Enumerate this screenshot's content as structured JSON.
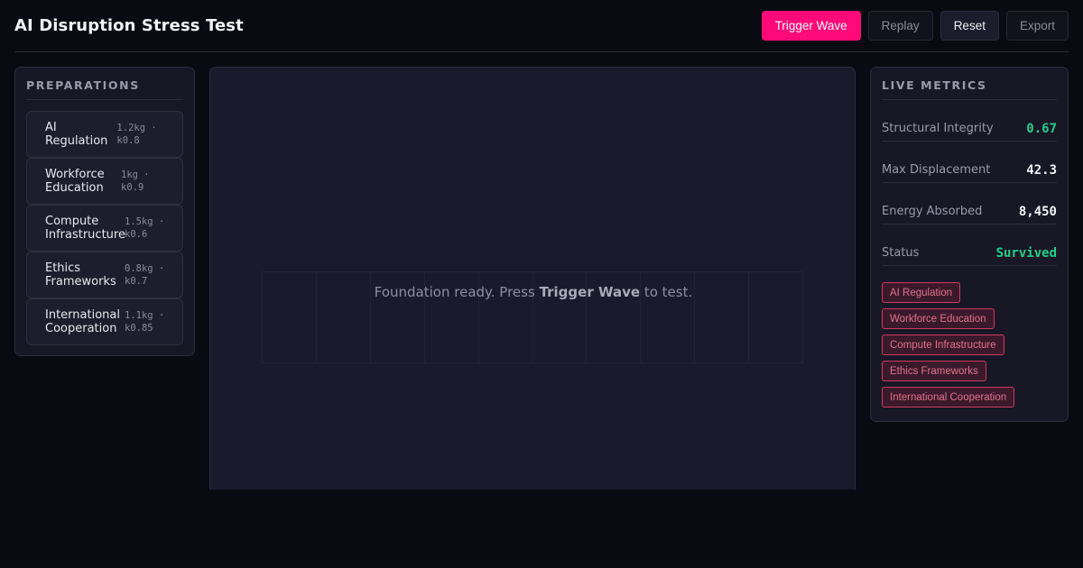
{
  "header": {
    "title": "AI Disruption Stress Test",
    "buttons": {
      "trigger": "Trigger Wave",
      "replay": "Replay",
      "reset": "Reset",
      "export": "Export"
    }
  },
  "preparations": {
    "title": "PREPARATIONS",
    "items": [
      {
        "name": "AI Regulation",
        "meta": "1.2kg · k0.8"
      },
      {
        "name": "Workforce Education",
        "meta": "1kg · k0.9"
      },
      {
        "name": "Compute Infrastructure",
        "meta": "1.5kg · k0.6"
      },
      {
        "name": "Ethics Frameworks",
        "meta": "0.8kg · k0.7"
      },
      {
        "name": "International Cooperation",
        "meta": "1.1kg · k0.85"
      }
    ]
  },
  "stage": {
    "message_prefix": "Foundation ready. Press",
    "message_action": "Trigger Wave",
    "message_suffix": "to test."
  },
  "metrics": {
    "title": "LIVE METRICS",
    "rows": [
      {
        "label": "Structural Integrity",
        "value": "0.67"
      },
      {
        "label": "Max Displacement",
        "value": "42.3"
      },
      {
        "label": "Energy Absorbed",
        "value": "8,450"
      },
      {
        "label": "Status",
        "value": "Survived"
      }
    ],
    "tags": [
      "AI Regulation",
      "Workforce Education",
      "Compute Infrastructure",
      "Ethics Frameworks",
      "International Cooperation"
    ]
  },
  "colors": {
    "accent": "#ff0a78",
    "success": "#22d08a",
    "tag": "#d0385f"
  }
}
